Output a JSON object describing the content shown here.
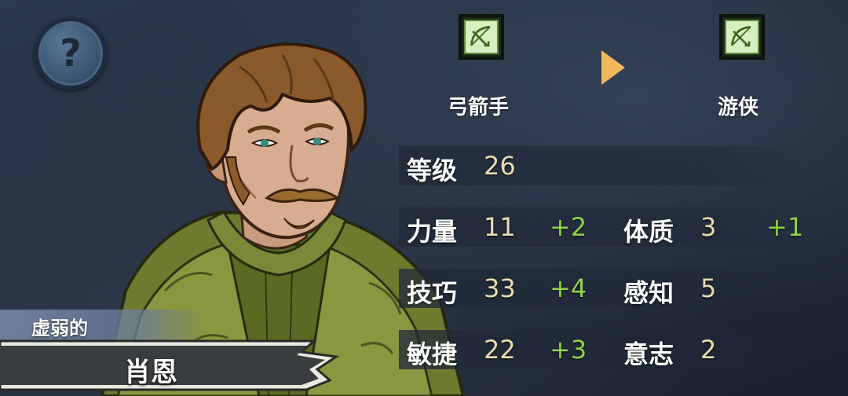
{
  "help_button": {
    "icon": "question-icon",
    "glyph": "?"
  },
  "character": {
    "epithet": "虚弱的",
    "name": "肖恩"
  },
  "class_progression": {
    "current": {
      "label": "弓箭手",
      "icon": "bow-icon"
    },
    "arrow_icon": "play-arrow-icon",
    "next": {
      "label": "游侠",
      "icon": "bow-icon"
    }
  },
  "stats": {
    "level": {
      "label": "等级",
      "value": "26"
    },
    "strength": {
      "label": "力量",
      "value": "11",
      "bonus": "+2"
    },
    "constitution": {
      "label": "体质",
      "value": "3",
      "bonus": "+1"
    },
    "skill": {
      "label": "技巧",
      "value": "33",
      "bonus": "+4"
    },
    "perception": {
      "label": "感知",
      "value": "5"
    },
    "agility": {
      "label": "敏捷",
      "value": "22",
      "bonus": "+3"
    },
    "willpower": {
      "label": "意志",
      "value": "2"
    }
  },
  "colors": {
    "value": "#e9ddb0",
    "bonus": "#8fd24a",
    "arrow": "#f0b85a"
  }
}
